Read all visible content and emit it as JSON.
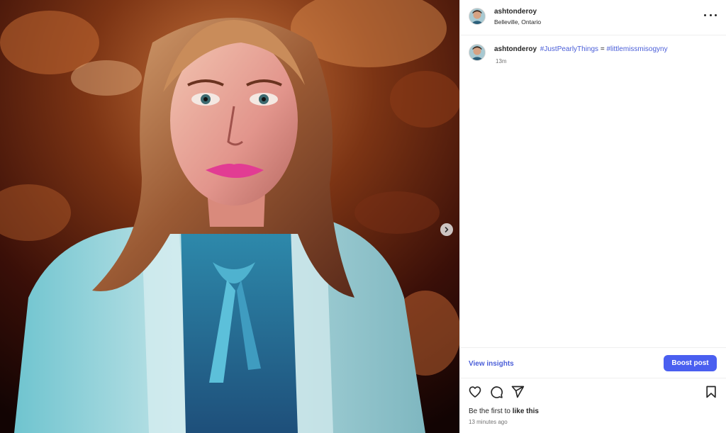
{
  "post": {
    "media": {
      "alt": "",
      "next_button_icon": "chevron-right-icon",
      "carousel_has_next": true
    },
    "header": {
      "username": "ashtonderoy",
      "location": "Belleville, Ontario",
      "more_icon": "more-horizontal-icon"
    },
    "caption": {
      "username": "ashtonderoy",
      "hashtag_1": "#JustPearlyThings",
      "separator": " = ",
      "hashtag_2": "#littlemissmisogyny",
      "time": "13m"
    },
    "actions": {
      "insights_label": "View insights",
      "boost_label": "Boost post"
    },
    "icons": {
      "like": "heart-icon",
      "comment": "comment-bubble-icon",
      "share": "paper-plane-icon",
      "save": "bookmark-icon"
    },
    "likes": {
      "prefix": "Be the first to ",
      "emphasis": "like this"
    },
    "timestamp": "13 minutes ago"
  },
  "colors": {
    "link_blue": "#4a5ed8",
    "boost_button": "#4a5ff0",
    "text": "#262626",
    "muted_text": "#737373"
  }
}
